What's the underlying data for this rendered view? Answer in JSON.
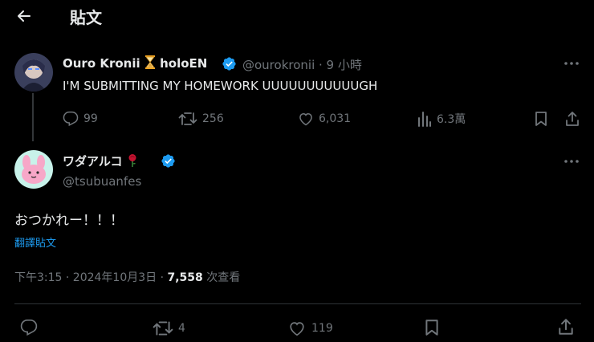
{
  "header": {
    "title": "貼文"
  },
  "parent_post": {
    "display_name": "Ouro Kronii",
    "name_suffix": "holoEN",
    "handle_time": "@ourokronii · 9 小時",
    "text": "I'M SUBMITTING MY HOMEWORK UUUUUUUUUUUGH",
    "actions": {
      "replies": "99",
      "reposts": "256",
      "likes": "6,031",
      "views": "6.3萬"
    }
  },
  "main_post": {
    "display_name": "ワダアルコ",
    "handle": "@tsubuanfes",
    "text": "おつかれー！！！",
    "translate_label": "翻譯貼文",
    "timestamp": "下午3:15 · 2024年10月3日 · ",
    "views_count": "7,558",
    "views_label": " 次查看",
    "actions": {
      "reposts": "4",
      "likes": "119"
    }
  },
  "colors": {
    "background": "#000000",
    "text_primary": "#e7e9ea",
    "text_secondary": "#71767b",
    "accent_blue": "#1d9bf0",
    "verified_badge": "#1d9bf0"
  }
}
